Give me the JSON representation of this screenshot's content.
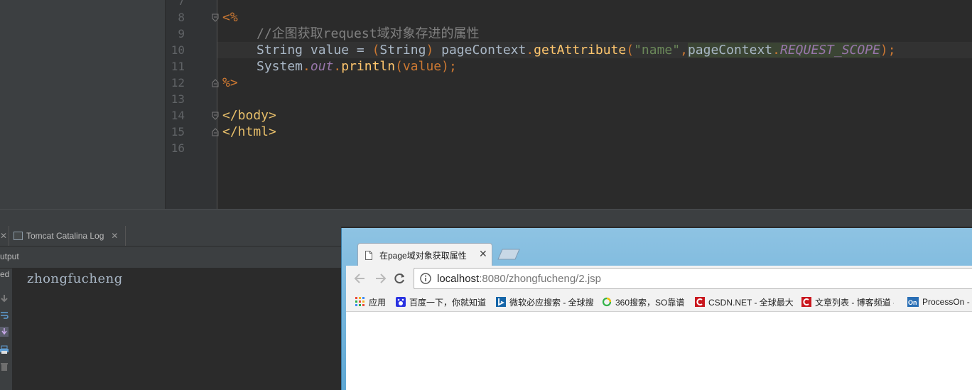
{
  "editor": {
    "line_numbers": [
      "7",
      "8",
      "9",
      "10",
      "11",
      "12",
      "13",
      "14",
      "15",
      "16"
    ],
    "lines": {
      "l8_tag": "<%",
      "l9_comment": "//企图获取request域对象存进的属性",
      "l10_a": "String value = ",
      "l10_paren_open": "(",
      "l10_cast": "String",
      "l10_paren_close": ")",
      "l10_obj": " pageContext",
      "l10_dot": ".",
      "l10_method": "getAttribute",
      "l10_open": "(",
      "l10_str": "\"name\"",
      "l10_comma": ",",
      "l10_ctx2": "pageContext",
      "l10_dot2": ".",
      "l10_field": "REQUEST_SCOPE",
      "l10_close": ")",
      "l10_semi": ";",
      "l11_sys": "System",
      "l11_dot": ".",
      "l11_out": "out",
      "l11_dot2": ".",
      "l11_println": "println",
      "l11_args": "(value)",
      "l11_semi": ";",
      "l12_tag": "%>",
      "l14_tag": "</body>",
      "l15_tag": "</html>"
    }
  },
  "tool_window": {
    "tabs": [
      {
        "label": "Tomcat Catalina Log",
        "close": "✕"
      }
    ],
    "stub_close": "✕",
    "output_label": "utput",
    "strip_label": "ed",
    "console_text": "zhongfucheng"
  },
  "browser": {
    "tab_title": "在page域对象获取属性",
    "tab_close": "✕",
    "url_host": "localhost",
    "url_rest": ":8080/zhongfucheng/2.jsp",
    "bookmarks": [
      {
        "label": "应用",
        "icon": "apps-grid-icon"
      },
      {
        "label": "百度一下，你就知道",
        "icon": "baidu-paw-icon"
      },
      {
        "label": "微软必应搜索 - 全球搜",
        "icon": "bing-icon"
      },
      {
        "label": "360搜索，SO靠谱",
        "icon": "360-search-icon"
      },
      {
        "label": "CSDN.NET - 全球最大",
        "icon": "csdn-icon"
      },
      {
        "label": "文章列表 - 博客频道 -",
        "icon": "csdn-icon"
      },
      {
        "label": "ProcessOn -",
        "icon": "processon-icon"
      }
    ]
  },
  "colors": {
    "editor_bg": "#2b2b2b",
    "keyword_orange": "#cc7832",
    "tag_yellow": "#e8bf6a",
    "string_green": "#6a8759",
    "method_yellow": "#ffc66d",
    "field_purple": "#9876aa",
    "chrome_frame_blue": "#5ea7d3"
  }
}
